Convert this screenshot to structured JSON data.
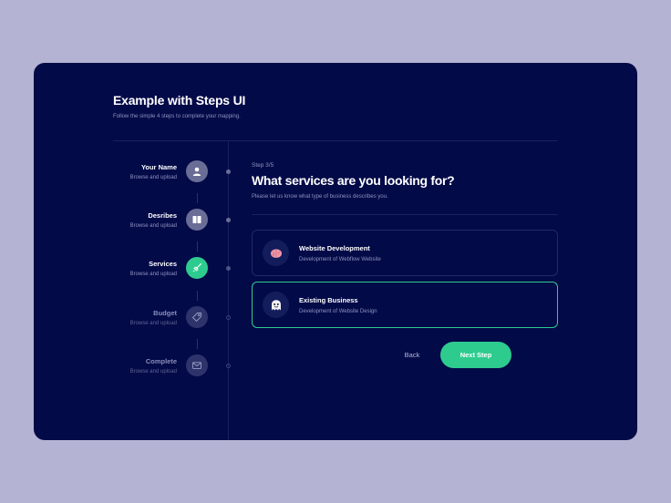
{
  "header": {
    "title": "Example with Steps UI",
    "subtitle": "Follow the simple 4 steps to complete your mapping."
  },
  "steps": [
    {
      "label": "Your Name",
      "desc": "Browse and upload",
      "icon": "user-icon"
    },
    {
      "label": "Desribes",
      "desc": "Browse and upload",
      "icon": "book-icon"
    },
    {
      "label": "Services",
      "desc": "Browse and upload",
      "icon": "rocket-icon"
    },
    {
      "label": "Budget",
      "desc": "Browse and upload",
      "icon": "tag-icon"
    },
    {
      "label": "Complete",
      "desc": "Browse and upload",
      "icon": "mail-icon"
    }
  ],
  "main": {
    "step_number": "Step 3/5",
    "heading": "What services are you looking for?",
    "hint": "Please let us know what type of business describes you.",
    "options": [
      {
        "title": "Website Development",
        "desc": "Development of Webflow Website",
        "icon": "brain-icon",
        "selected": false
      },
      {
        "title": "Existing Business",
        "desc": "Development of Website Design",
        "icon": "ghost-icon",
        "selected": true
      }
    ]
  },
  "actions": {
    "back_label": "Back",
    "next_label": "Next Step"
  },
  "colors": {
    "background": "#b4b3d3",
    "card": "#030a48",
    "accent": "#2ecb8f",
    "text_muted": "#8f93c0"
  }
}
